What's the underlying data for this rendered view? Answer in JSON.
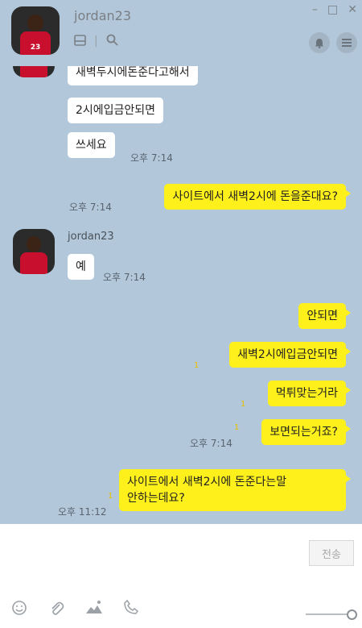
{
  "window": {
    "title": "jordan23"
  },
  "avatar": {
    "jersey_number": "23"
  },
  "messages": [
    {
      "side": "in",
      "text": "새벽두시에돈준다고해서"
    },
    {
      "side": "in",
      "text": "2시에입금안되면"
    },
    {
      "side": "in",
      "text": "쓰세요",
      "time": "오후 7:14"
    },
    {
      "side": "out",
      "text": "사이트에서 새벽2시에 돈을준대요?",
      "time": "오후 7:14"
    },
    {
      "side": "in",
      "sender": "jordan23",
      "text": "예",
      "time": "오후 7:14"
    },
    {
      "side": "out",
      "text": "안되면"
    },
    {
      "side": "out",
      "text": "새벽2시에입금안되면",
      "unread": "1"
    },
    {
      "side": "out",
      "text": "먹튀맞는거라",
      "unread": "1"
    },
    {
      "side": "out",
      "text": "보면되는거죠?",
      "unread": "1",
      "time": "오후 7:14"
    },
    {
      "side": "out",
      "text_line1": "사이트에서 새벽2시에 돈준다는말",
      "text_line2": "안하는데요?",
      "unread": "1",
      "time": "오후 11:12"
    }
  ],
  "input": {
    "send_label": "전송"
  },
  "icons": {
    "drawer": "drawer-icon",
    "search": "search-icon",
    "bell": "bell-icon",
    "menu": "menu-icon",
    "emoji": "emoji-icon",
    "attach": "paperclip-icon",
    "image": "image-icon",
    "call": "phone-icon"
  },
  "colors": {
    "bg": "#b2c7d9",
    "outgoing": "#fef01b",
    "incoming": "#ffffff"
  }
}
